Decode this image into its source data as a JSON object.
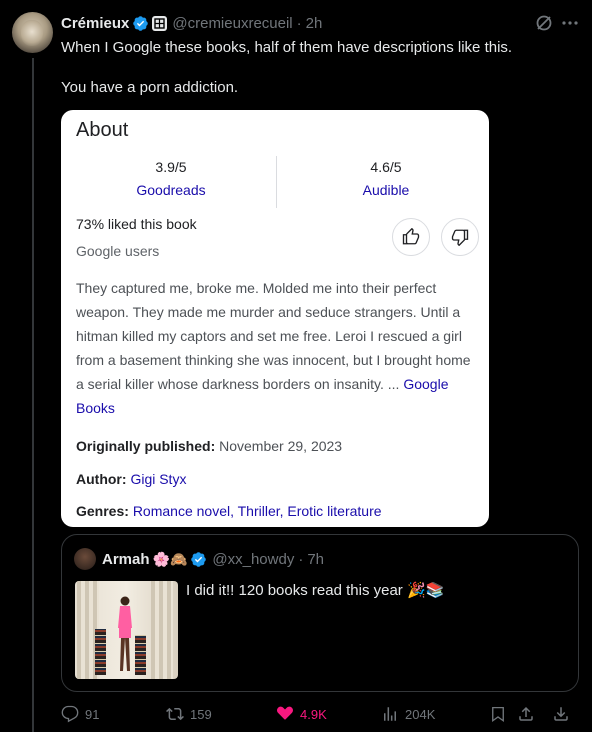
{
  "tweet": {
    "author_name": "Crémieux",
    "handle": "@cremieuxrecueil",
    "separator": "·",
    "time": "2h",
    "text_line1": "When I Google these books, half of them have descriptions like this.",
    "text_line2": "You have a porn addiction."
  },
  "card": {
    "title": "About",
    "rating1_score": "3.9/5",
    "rating1_source": "Goodreads",
    "rating2_score": "4.6/5",
    "rating2_source": "Audible",
    "liked": "73% liked this book",
    "liked_by": "Google users",
    "description": "They captured me, broke me. Molded me into their perfect weapon. They made me murder and seduce strangers. Until a hitman killed my captors and set me free. Leroi I rescued a girl from a basement thinking she was innocent, but I brought home a serial killer whose darkness borders on insanity. ...",
    "description_link": "Google Books",
    "published_label": "Originally published:",
    "published_value": "November 29, 2023",
    "author_label": "Author:",
    "author_value": "Gigi Styx",
    "genres_label": "Genres:",
    "genres_value": "Romance novel, Thriller, Erotic literature"
  },
  "quote": {
    "author_name": "Armah",
    "emojis": "🌸🙈",
    "handle": "@xx_howdy",
    "separator": "·",
    "time": "7h",
    "text": "I did it!! 120 books read this year 🎉📚"
  },
  "actions": {
    "replies": "91",
    "reposts": "159",
    "likes": "4.9K",
    "views": "204K"
  },
  "colors": {
    "background": "#000000",
    "verified_blue": "#1d9bf0",
    "like_pink": "#f91880",
    "google_link": "#1a0dab"
  }
}
